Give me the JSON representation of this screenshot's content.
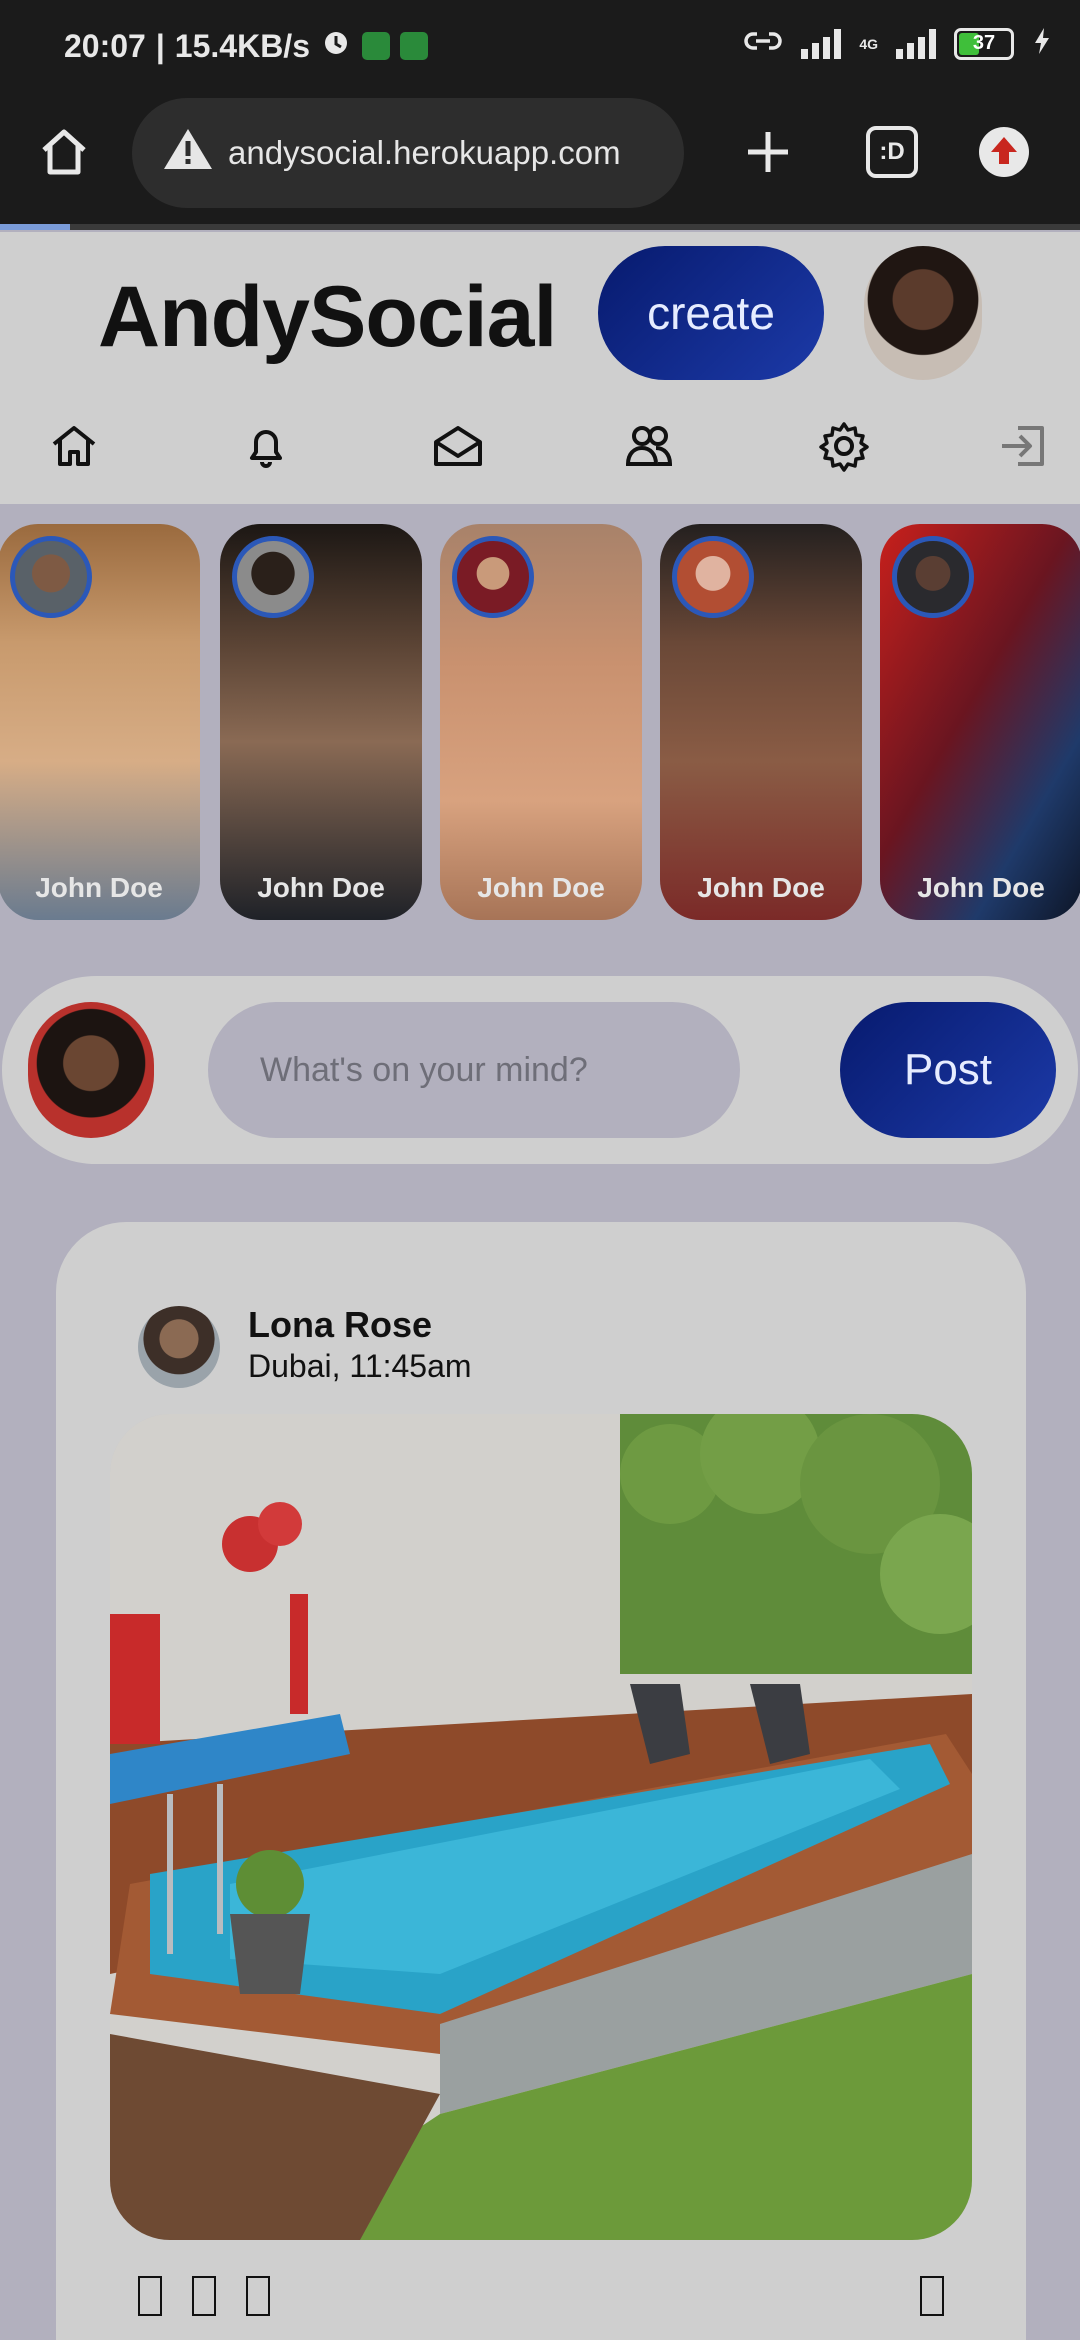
{
  "status_bar": {
    "time": "20:07",
    "speed": "15.4KB/s",
    "network": "4G",
    "battery": "37"
  },
  "browser": {
    "url": "andysocial.herokuapp.com",
    "tab_count": ":D"
  },
  "app": {
    "logo": "AndySocial",
    "create_label": "create",
    "nav": [
      "home-icon",
      "bell-icon",
      "mail-icon",
      "friends-icon",
      "gear-icon",
      "logout-icon"
    ]
  },
  "stories": [
    {
      "name": "John Doe"
    },
    {
      "name": "John Doe"
    },
    {
      "name": "John Doe"
    },
    {
      "name": "John Doe"
    },
    {
      "name": "John Doe"
    }
  ],
  "composer": {
    "placeholder": "What's on your mind?",
    "post_label": "Post"
  },
  "post": {
    "author": "Lona Rose",
    "meta": "Dubai, 11:45am"
  },
  "colors": {
    "accent": "#0b2284",
    "page_bg": "#b2b0be",
    "card_bg": "#cfcfcf"
  }
}
